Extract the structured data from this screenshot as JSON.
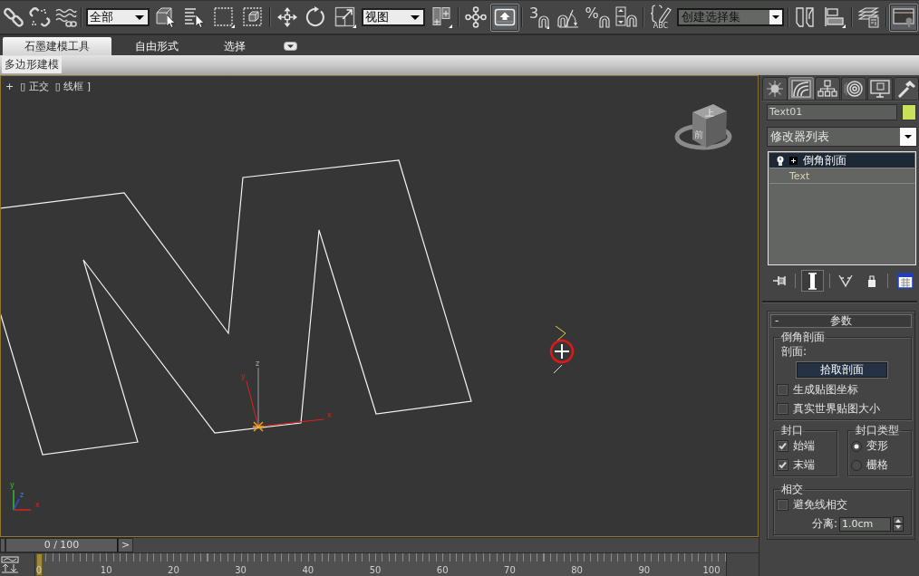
{
  "main_toolbar": [
    {
      "kind": "button",
      "active": false
    },
    {
      "kind": "button",
      "active": false
    },
    {
      "kind": "button",
      "active": false
    },
    {
      "kind": "separator"
    },
    {
      "kind": "dropdown",
      "value": "全部"
    },
    {
      "kind": "button",
      "active": false
    },
    {
      "kind": "button",
      "active": false
    },
    {
      "kind": "button",
      "active": false
    },
    {
      "kind": "button",
      "active": false
    },
    {
      "kind": "separator"
    },
    {
      "kind": "button",
      "active": false
    },
    {
      "kind": "button",
      "active": false
    },
    {
      "kind": "button",
      "active": false
    },
    {
      "kind": "dropdown",
      "value": "视图"
    },
    {
      "kind": "button",
      "active": false
    },
    {
      "kind": "separator"
    },
    {
      "kind": "button",
      "active": false
    },
    {
      "kind": "button",
      "active": true
    },
    {
      "kind": "separator"
    },
    {
      "kind": "snap",
      "text": "3",
      "active": false
    },
    {
      "kind": "button",
      "active": false
    },
    {
      "kind": "snap",
      "text": "%",
      "active": false
    },
    {
      "kind": "button",
      "active": false
    },
    {
      "kind": "separator"
    },
    {
      "kind": "caption",
      "text": "ABC",
      "active": false
    },
    {
      "kind": "combo",
      "placeholder": "创建选择集"
    },
    {
      "kind": "separator"
    },
    {
      "kind": "button",
      "active": false
    },
    {
      "kind": "button",
      "active": false
    },
    {
      "kind": "separator"
    },
    {
      "kind": "button",
      "active": false
    },
    {
      "kind": "separator"
    },
    {
      "kind": "button",
      "active": true
    }
  ],
  "ribbon": {
    "tabs": [
      {
        "label": "石墨建模工具",
        "selected": true
      },
      {
        "label": "自由形式",
        "selected": false
      },
      {
        "label": "选择",
        "selected": false
      }
    ],
    "panels": [
      {
        "label": "多边形建模",
        "selected": true
      }
    ]
  },
  "viewport": {
    "active": true,
    "menus": [
      "+",
      "▯ 正交",
      "▯ 线框 ]"
    ],
    "viewcube_faces": [
      "上",
      "前"
    ],
    "gizmo_axes": [
      "x",
      "y",
      "z"
    ],
    "tripod_axes": [
      "x",
      "y",
      "z"
    ]
  },
  "command_panel": {
    "tabs": [
      {
        "selected": false
      },
      {
        "selected": true
      },
      {
        "selected": false
      },
      {
        "selected": false
      },
      {
        "selected": false
      },
      {
        "selected": false
      }
    ],
    "object": {
      "name": "Text01",
      "color": "#c8e05a"
    },
    "modifier_list": "修改器列表",
    "stack": [
      {
        "kind": "modifier",
        "label": "倒角剖面",
        "selected": true,
        "enabled": true,
        "expanded": false
      },
      {
        "kind": "base",
        "label": "Text",
        "selected": false
      }
    ],
    "stack_buttons": [
      {
        "active": false
      },
      {
        "active": true
      },
      {
        "active": false
      },
      {
        "active": false
      },
      {
        "active": false
      }
    ],
    "rollout": {
      "sign": "-",
      "title": "参数",
      "rows": [
        [
          {
            "title": "倒角剖面",
            "controls": [
              {
                "kind": "label",
                "text": "剖面:"
              },
              {
                "kind": "button",
                "label": "拾取剖面"
              },
              {
                "kind": "checkbox",
                "label": "生成贴图坐标",
                "checked": false
              },
              {
                "kind": "checkbox",
                "label": "真实世界贴图大小",
                "checked": false
              }
            ]
          }
        ],
        [
          {
            "title": "封口",
            "controls": [
              {
                "kind": "checkbox",
                "label": "始端",
                "checked": true
              },
              {
                "kind": "checkbox",
                "label": "末端",
                "checked": true
              }
            ]
          },
          {
            "title": "封口类型",
            "controls": [
              {
                "kind": "radio",
                "label": "变形",
                "selected": true
              },
              {
                "kind": "radio",
                "label": "栅格",
                "selected": false
              }
            ]
          }
        ],
        [
          {
            "title": "相交",
            "controls": [
              {
                "kind": "checkbox",
                "label": "避免线相交",
                "checked": false
              },
              {
                "kind": "spinner",
                "label": "分离:",
                "value": "1.0cm"
              }
            ]
          }
        ]
      ]
    }
  },
  "time_slider": {
    "reading": "0 / 100",
    "level": 0,
    "next": ">"
  },
  "track_bar": {
    "labels": [
      "0",
      "10",
      "20",
      "30",
      "40",
      "50",
      "60",
      "70",
      "80",
      "90",
      "100"
    ]
  }
}
